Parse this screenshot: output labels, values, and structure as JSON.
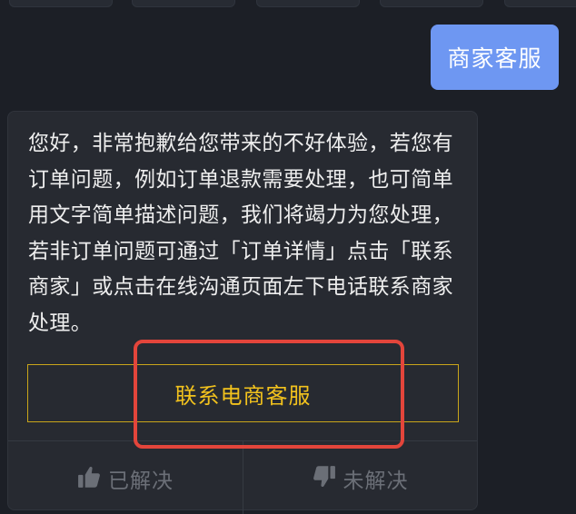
{
  "user_message": {
    "text": "商家客服"
  },
  "reply": {
    "text": "您好，非常抱歉给您带来的不好体验，若您有订单问题，例如订单退款需要处理，也可简单用文字简单描述问题，我们将竭力为您处理，若非订单问题可通过「订单详情」点击「联系商家」或点击在线沟通页面左下电话联系商家处理。",
    "contact_button_label": "联系电商客服",
    "feedback": {
      "solved_label": "已解决",
      "unsolved_label": "未解决"
    }
  },
  "colors": {
    "background": "#1c1f26",
    "user_bubble": "#6e97f2",
    "card": "#272a31",
    "accent_gold": "#f2c21d",
    "highlight_red": "#e3453b",
    "muted_text": "#6b6f77"
  },
  "icons": {
    "solved": "thumbs-up-icon",
    "unsolved": "thumbs-down-icon"
  }
}
